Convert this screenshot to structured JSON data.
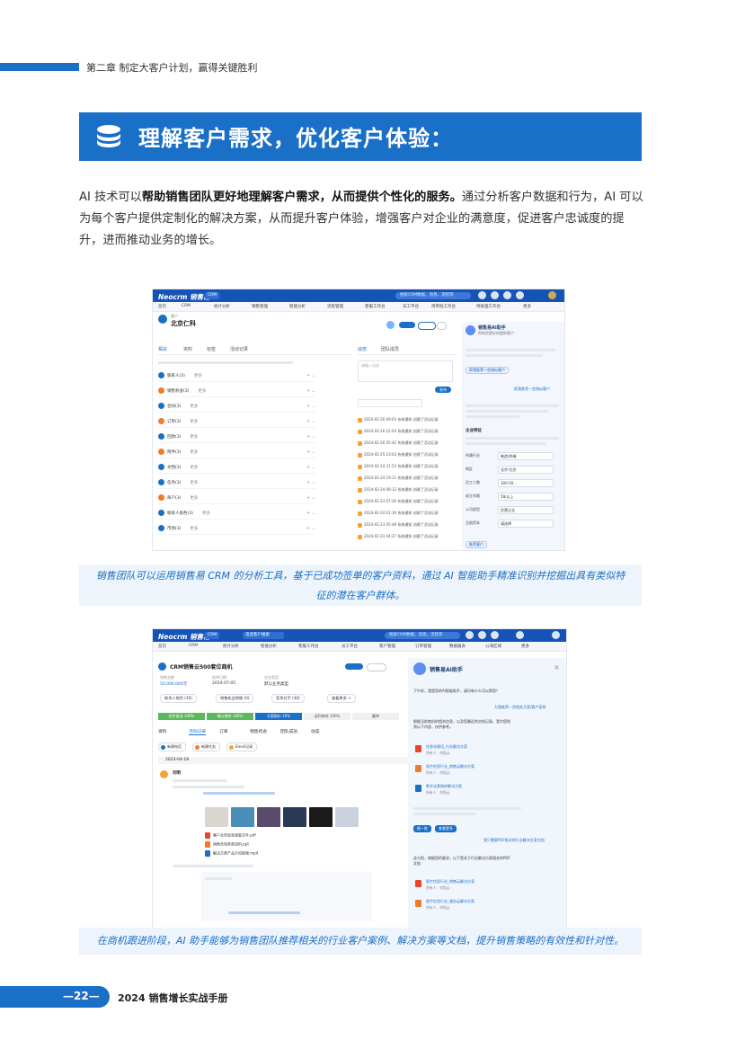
{
  "chapter": {
    "title": "第二章 制定大客户计划，赢得关键胜利"
  },
  "section": {
    "title": "理解客户需求，优化客户体验："
  },
  "intro": {
    "part1": "AI 技术可以",
    "bold": "帮助销售团队更好地理解客户需求，从而提供个性化的服务。",
    "part2": "通过分析客户数据和行为，AI 可以为每个客户提供定制化的解决方案，从而提升客户体验，增强客户对企业的满意度，促进客户忠诚度的提升，进而推动业务的增长。"
  },
  "screenshot1": {
    "logo": "Neocrm 销售易",
    "module": "CRM",
    "search_placeholder": "搜索CRM数据、消息、流程等",
    "nav": [
      "首页",
      "CRM",
      "统计分析",
      "销售管理",
      "智能分析",
      "流程管理",
      "客服工作台",
      "员工平台",
      "待审批工作台",
      "待处理工作台",
      "更多"
    ],
    "customer_type": "客户",
    "customer_name": "北京仁科",
    "tabs": [
      "相关",
      "资料",
      "标签",
      "活动记录"
    ],
    "related_items": [
      {
        "label": "联系人(3)",
        "more": "更多",
        "color": "#1a6fc7"
      },
      {
        "label": "销售机会(3)",
        "more": "更多",
        "color": "#f07b2a"
      },
      {
        "label": "合同(3)",
        "more": "更多",
        "color": "#1a6fc7"
      },
      {
        "label": "订单(3)",
        "more": "更多",
        "color": "#f07b2a"
      },
      {
        "label": "回款(3)",
        "more": "更多",
        "color": "#1a6fc7"
      },
      {
        "label": "附件(3)",
        "more": "更多",
        "color": "#f07b2a"
      },
      {
        "label": "文档(3)",
        "more": "更多",
        "color": "#1a6fc7"
      },
      {
        "label": "任务(3)",
        "more": "更多",
        "color": "#1a6fc7"
      },
      {
        "label": "商户(3)",
        "more": "更多",
        "color": "#f07b2a"
      },
      {
        "label": "联系人角色(3)",
        "more": "更多",
        "color": "#1a6fc7"
      },
      {
        "label": "市场(3)",
        "more": "更多",
        "color": "#1a6fc7"
      }
    ],
    "activity_tabs": [
      "动态",
      "团队成员"
    ],
    "activity_input_placeholder": "请输入动态",
    "publish": "发布",
    "log_entries": [
      "2024-02-26 09:03 系统通知 创建了活动记录",
      "2024-02-26 22:03 系统通知 创建了活动记录",
      "2024-02-26 05:42 系统通知 创建了活动记录",
      "2024-02-25 23:03 系统通知 创建了活动记录",
      "2024-02-24 21:53 系统通知 创建了活动记录",
      "2024-02-24 19:11 系统通知 创建了活动记录",
      "2024-02-24 08:12 系统通知 创建了活动记录",
      "2024-02-23 07:26 系统通知 创建了活动记录",
      "2024-02-24 01:36 系统通知 创建了活动记录",
      "2024-02-23 05:48 系统通知 创建了活动记录",
      "2024-02-23 04:27 系统通知 创建了活动记录"
    ],
    "ai_title": "销售易AI助手",
    "ai_subtitle": "帮助您更好的跟踪客户",
    "ai_button": "帮我推荐一些相似客户",
    "ai_reply_button": "帮我推荐一些相似客户",
    "filter_title": "企业特征",
    "filter_rows": [
      {
        "label": "所属行业",
        "value": "制造/终端"
      },
      {
        "label": "地区",
        "value": "北京-北京"
      },
      {
        "label": "员工人数",
        "value": "300-50..."
      },
      {
        "label": "成立年限",
        "value": "5年以上"
      },
      {
        "label": "公司类型",
        "value": "民营企业"
      },
      {
        "label": "注册资本",
        "value": "请选择"
      }
    ],
    "filter_confirm": "推荐客户"
  },
  "caption1": "销售团队可以运用销售易 CRM 的分析工具，基于已成功签单的客户资料，通过 AI 智能助手精准识别并挖掘出具有类似特征的潜在客户群体。",
  "screenshot2": {
    "logo": "Neocrm 销售易",
    "module": "CRM",
    "tab_search": "电话客户搜索",
    "search_placeholder": "搜索CRM数据、消息、流程等",
    "nav": [
      "首页",
      "CRM",
      "统计分析",
      "智能分析",
      "客服工作台",
      "员工平台",
      "客户管理",
      "订单管理",
      "数据报表",
      "公海区域",
      "更多"
    ],
    "opportunity_title": "CRM销售云500套位商机",
    "fields": [
      {
        "label": "销售金额",
        "value": "50,000,000元"
      },
      {
        "label": "结单日期",
        "value": "2024-07-05"
      },
      {
        "label": "业务类型",
        "value": "默认业务类型"
      }
    ],
    "links": [
      "联系人角色 (30)",
      "销售机会明细 (0)",
      "竞争对手 (30)",
      "查看更多 >"
    ],
    "stages": [
      "初步接洽 100%",
      "确认需求 100%",
      "方案报价 20%",
      "谈判审核 100%",
      "赢单"
    ],
    "tabs": [
      "资料",
      "活动记录",
      "订单",
      "销售机会",
      "团队成员",
      "动态"
    ],
    "actions": [
      "新建电话",
      "新建任务",
      "Email记录"
    ],
    "date_group": "2023-04-18",
    "record_user": "刘明",
    "attachments": [
      "客户业务现状调查文件.pdf",
      "销售合同条款资料.ppt",
      "解决方案产品介绍视频.mp4"
    ],
    "ai_title": "销售易AI助手",
    "ai_greeting": "下午好，我是您的AI智能助手，请问有什么可以帮您？",
    "user_q1": "为我推荐一些相关方案/客户案例",
    "ai_answer": "根据当前商机的相关信息，以及您最近的文档记录，我为您找到以下内容，仅供参考。",
    "docs1": [
      {
        "name": "信息化建设_行业解决方案",
        "owner": "所有人：刘陆云"
      },
      {
        "name": "医疗信息行业_销售云解决方案",
        "owner": "所有人：刘陆云"
      },
      {
        "name": "数字化营销的解决方案",
        "owner": "所有人：刘陆云"
      }
    ],
    "chips": [
      "换一批",
      "查看更多"
    ],
    "user_q2": "我只需要PDF格式的行业解决方案文档",
    "ai_answer2": "这与您，根据您的要求，以下是关于行业解决方案相关的PDF文档",
    "docs2": [
      {
        "name": "医疗信息行业_销售云解决方案",
        "owner": "所有人：刘陆云"
      },
      {
        "name": "医疗信息行业_服务云解决方案",
        "owner": "所有人：刘陆云"
      }
    ]
  },
  "caption2": "在商机跟进阶段，AI 助手能够为销售团队推荐相关的行业客户案例、解决方案等文档，提升销售策略的有效性和针对性。",
  "footer": {
    "page": "—22—",
    "title": "2024 销售增长实战手册"
  },
  "colors": {
    "brand_blue": "#1a6fc7",
    "header_blue": "#1554b6",
    "accent_orange": "#f07b2a",
    "caption_bg": "#eef4fb"
  }
}
